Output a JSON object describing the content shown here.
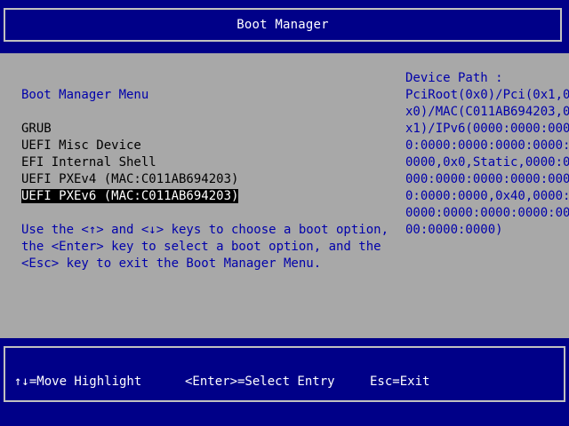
{
  "header": {
    "title": "Boot Manager"
  },
  "menu": {
    "title": "Boot Manager Menu",
    "items": [
      {
        "label": "GRUB"
      },
      {
        "label": "UEFI Misc Device"
      },
      {
        "label": "EFI Internal Shell"
      },
      {
        "label": "UEFI PXEv4 (MAC:C011AB694203)"
      },
      {
        "label": "UEFI PXEv6 (MAC:C011AB694203)"
      }
    ],
    "selected_index": 4
  },
  "help": {
    "lines": [
      "Use the <↑> and <↓> keys to choose a boot option,",
      "the <Enter> key to select a boot option, and the",
      "<Esc> key to exit the Boot Manager Menu."
    ]
  },
  "device_path": {
    "label": "Device Path :",
    "lines": [
      "PciRoot(0x0)/Pci(0x1,0",
      "x0)/MAC(C011AB694203,0",
      "x1)/IPv6(0000:0000:000",
      "0:0000:0000:0000:0000:",
      "0000,0x0,Static,0000:0",
      "000:0000:0000:0000:000",
      "0:0000:0000,0x40,0000:",
      "0000:0000:0000:0000:00",
      "00:0000:0000)"
    ]
  },
  "footer": {
    "move": "↑↓=Move Highlight",
    "select": "<Enter>=Select Entry",
    "exit": "Esc=Exit"
  }
}
